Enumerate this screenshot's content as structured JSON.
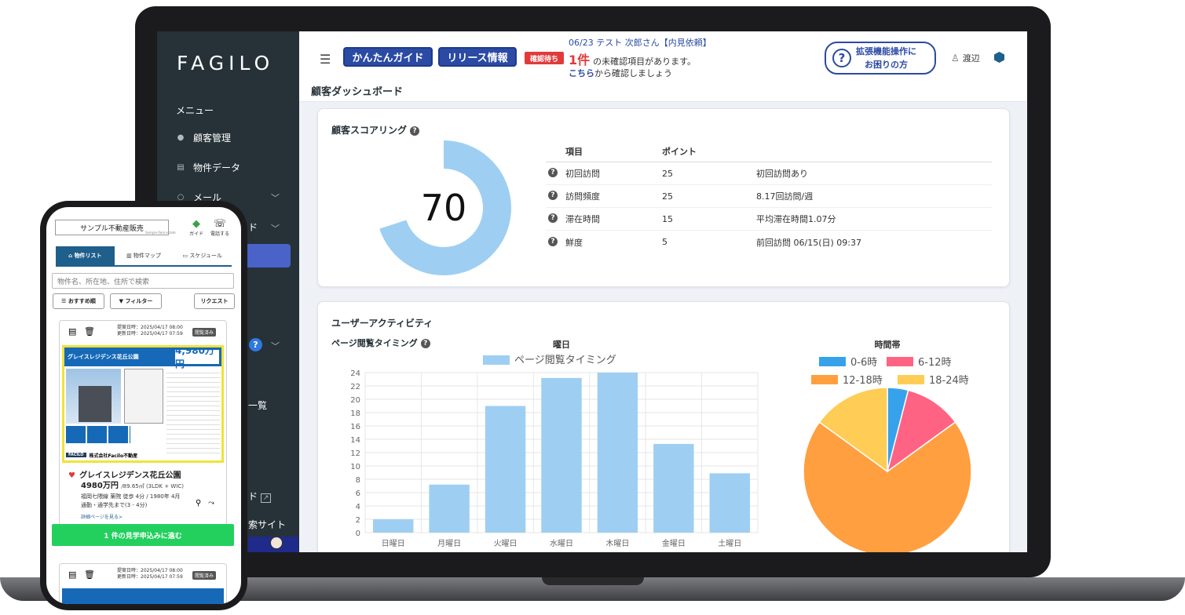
{
  "sidebar": {
    "logo": "FAGILO",
    "menu_label": "メニュー",
    "items": [
      {
        "label": "顧客管理"
      },
      {
        "label": "物件データ"
      },
      {
        "label": "メール"
      },
      {
        "label": "ド"
      }
    ],
    "fragments": [
      "一覧",
      "ド",
      "索サイト"
    ]
  },
  "header": {
    "guide_btn": "かんたんガイド",
    "release_btn": "リリース情報",
    "confirm_badge": "確認待ち",
    "notice_line1": "06/23 テスト 次郎さん【内見依頼】",
    "notice_count": "1件",
    "notice_line2": "の未確認項目があります。",
    "notice_link": "こちら",
    "notice_line3": "から確認しましょう",
    "help_pill_line1": "拡張機能操作に",
    "help_pill_line2": "お困りの方",
    "user_name": "渡辺",
    "page_title": "顧客ダッシュボード"
  },
  "scoring": {
    "title": "顧客スコアリング",
    "score": "70",
    "score_value": 70,
    "columns": [
      "項目",
      "ポイント",
      ""
    ],
    "rows": [
      {
        "item": "初回訪問",
        "point": "25",
        "detail": "初回訪問あり"
      },
      {
        "item": "訪問頻度",
        "point": "25",
        "detail": "8.17回訪問/週"
      },
      {
        "item": "滞在時間",
        "point": "15",
        "detail": "平均滞在時間1.07分"
      },
      {
        "item": "鮮度",
        "point": "5",
        "detail": "前回訪問 06/15(日) 09:37"
      }
    ]
  },
  "activity": {
    "title": "ユーザーアクティビティ",
    "subtitle": "ページ閲覧タイミング"
  },
  "chart_data": [
    {
      "type": "bar",
      "title": "曜日",
      "categories": [
        "日曜日",
        "月曜日",
        "火曜日",
        "水曜日",
        "木曜日",
        "金曜日",
        "土曜日"
      ],
      "series": [
        {
          "name": "ページ閲覧タイミング",
          "values": [
            2,
            7.2,
            19,
            23.2,
            24,
            13.3,
            8.9
          ]
        }
      ],
      "ylim": [
        0,
        24
      ],
      "yticks": [
        "0",
        "2",
        "4",
        "6",
        "8",
        "10",
        "12",
        "14",
        "16",
        "18",
        "20",
        "22",
        "24"
      ],
      "color": "#9ecff2",
      "grid": true,
      "legend": "top"
    },
    {
      "type": "pie",
      "title": "時間帯",
      "labels": [
        "0-6時",
        "6-12時",
        "12-18時",
        "18-24時"
      ],
      "values": [
        4,
        11,
        70,
        15
      ],
      "colors": [
        "#36a2eb",
        "#ff6384",
        "#ff9f40",
        "#ffcd56"
      ],
      "legend": "top"
    }
  ],
  "phone": {
    "store_name": "サンプル不動産販売",
    "store_sub": "Sample Real estate",
    "guide_label": "ガイド",
    "call_label": "電話する",
    "tabs": [
      "物件リスト",
      "物件マップ",
      "スケジュール"
    ],
    "search_placeholder": "物件名、所在地、住所で検索",
    "sort_btn": "おすすめ順",
    "filter_btn": "フィルター",
    "request_btn": "リクエスト",
    "meta_line1": "提案日時：2025/04/17 08:00",
    "meta_line2": "更新日時：2025/04/17 07:59",
    "seen_badge": "閲覧済み",
    "flyer_title": "グレイスレジデンス花丘公園",
    "flyer_price": "4,980万円",
    "flyer_company": "株式会社Facilo不動産",
    "flyer_logo": "FACILO",
    "property_name": "グレイスレジデンス花丘公園",
    "price": "4980万円",
    "price_detail": "/89.65㎡ (3LDK + WIC)",
    "address_line1": "福岡七隈線 薬院 徒歩 4分 / 1980年 4月",
    "address_line2": "通勤・通学先まで(3 - 4分)",
    "detail_link": "詳細ページを見る>",
    "cta": "1 件の見学申込みに進む"
  }
}
